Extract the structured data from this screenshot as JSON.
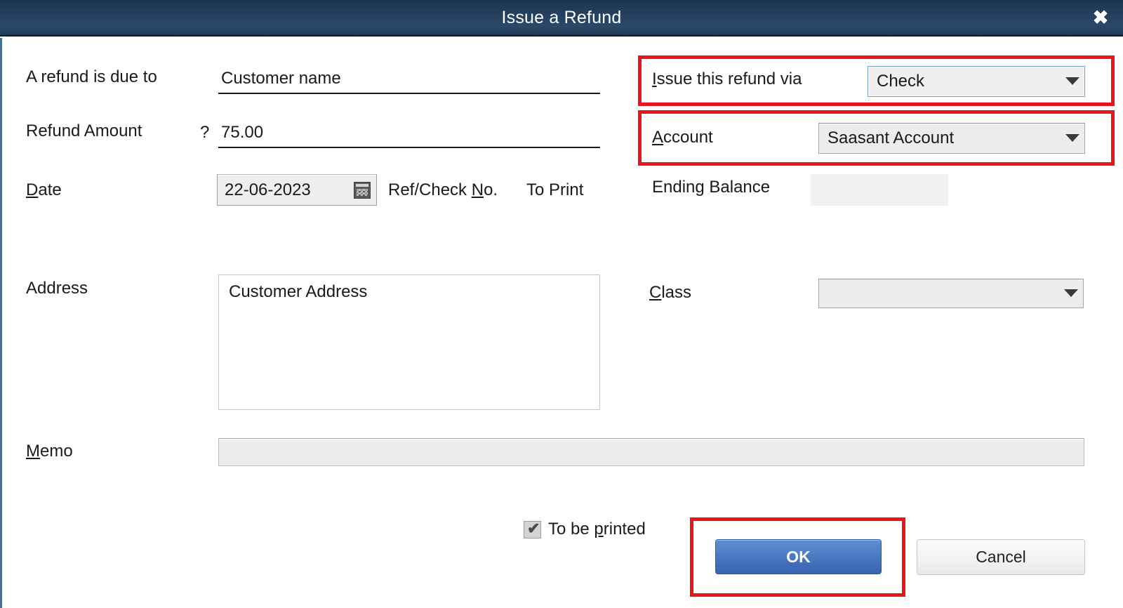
{
  "window": {
    "title": "Issue a Refund",
    "close_icon": "close-icon",
    "close_glyph": "✖"
  },
  "form": {
    "refund_due_to": {
      "label": "A refund is due to",
      "value": "Customer name"
    },
    "refund_amount": {
      "label": "Refund Amount",
      "currency_symbol": "?",
      "value": "75.00"
    },
    "date": {
      "label_accel": "D",
      "label_rest": "ate",
      "value": "22-06-2023",
      "calendar_icon": "calendar-icon"
    },
    "ref_check_no": {
      "label_pre": "Ref/Check ",
      "label_accel": "N",
      "label_post": "o.",
      "value": "To Print"
    },
    "address": {
      "label": "Address",
      "value": "Customer Address"
    },
    "memo": {
      "label_accel": "M",
      "label_rest": "emo",
      "value": ""
    },
    "issue_via": {
      "label_accel": "I",
      "label_rest": "ssue this refund via",
      "value": "Check",
      "arrow_icon": "chevron-down-icon"
    },
    "account": {
      "label_accel": "A",
      "label_rest": "ccount",
      "value": "Saasant Account",
      "arrow_icon": "chevron-down-icon"
    },
    "ending_balance": {
      "label": "Ending Balance",
      "value": ""
    },
    "class": {
      "label_accel": "C",
      "label_rest": "lass",
      "value": "",
      "arrow_icon": "chevron-down-icon"
    },
    "to_be_printed": {
      "label_pre": "To be ",
      "label_accel": "p",
      "label_post": "rinted",
      "checked": true,
      "check_glyph": "✔"
    }
  },
  "actions": {
    "ok_label": "OK",
    "cancel_label": "Cancel"
  },
  "colors": {
    "titlebar": "#25415f",
    "highlight_red": "#e8161a",
    "ok_button_blue": "#4f7fc6",
    "field_grey": "#ececec"
  }
}
